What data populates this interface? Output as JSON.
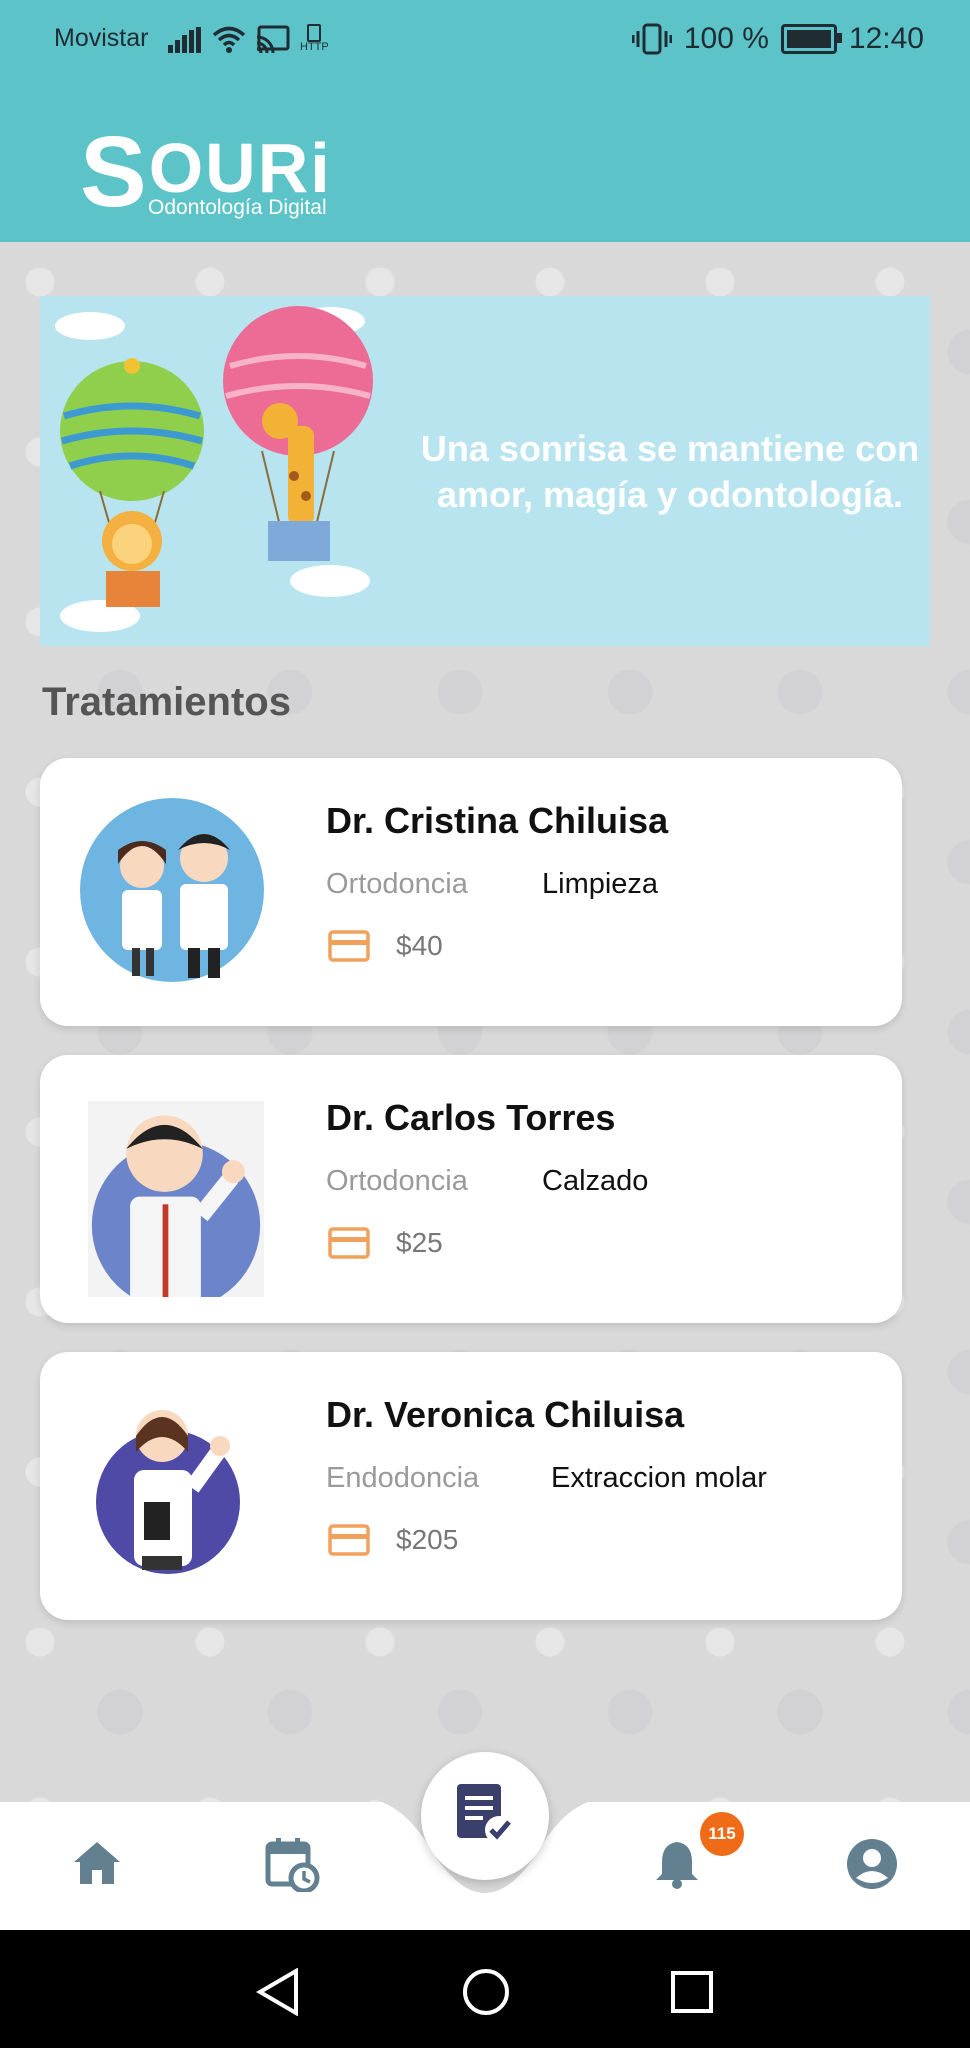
{
  "status_bar": {
    "carrier": "Movistar",
    "http_label": "HTTP",
    "battery_percent": "100 %",
    "time": "12:40"
  },
  "header": {
    "logo_text": "OURi",
    "logo_initial": "S",
    "logo_subtitle": "Odontología Digital"
  },
  "banner": {
    "line1": "Una sonrisa se mantiene con",
    "line2": "amor, magía y odontología."
  },
  "section_title": "Tratamientos",
  "treatments": [
    {
      "doctor": "Dr. Cristina Chiluisa",
      "specialty": "Ortodoncia",
      "treatment": "Limpieza",
      "price": "$40"
    },
    {
      "doctor": "Dr. Carlos Torres",
      "specialty": "Ortodoncia",
      "treatment": "Calzado",
      "price": "$25"
    },
    {
      "doctor": "Dr. Veronica Chiluisa",
      "specialty": "Endodoncia",
      "treatment": "Extraccion molar",
      "price": "$205"
    }
  ],
  "bottom_nav": {
    "items": [
      "home-icon",
      "calendar-clock-icon",
      "clipboard-check-icon",
      "bell-icon",
      "account-icon"
    ],
    "notification_count": "115"
  },
  "colors": {
    "primary": "#5cc3c9",
    "nav_icon": "#62808f",
    "accent_orange": "#ef6b18",
    "price_icon": "#f0a15c"
  }
}
